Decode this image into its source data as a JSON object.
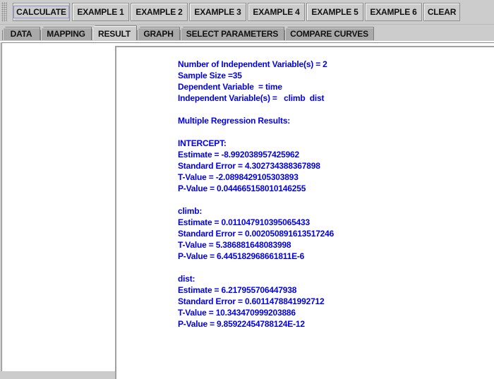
{
  "toolbar": {
    "buttons": [
      {
        "label": "CALCULATE"
      },
      {
        "label": "EXAMPLE 1"
      },
      {
        "label": "EXAMPLE 2"
      },
      {
        "label": "EXAMPLE 3"
      },
      {
        "label": "EXAMPLE 4"
      },
      {
        "label": "EXAMPLE 5"
      },
      {
        "label": "EXAMPLE 6"
      },
      {
        "label": "CLEAR"
      }
    ]
  },
  "tabs": [
    {
      "label": "DATA"
    },
    {
      "label": "MAPPING"
    },
    {
      "label": "RESULT",
      "active": true
    },
    {
      "label": "GRAPH"
    },
    {
      "label": "SELECT PARAMETERS"
    },
    {
      "label": "COMPARE CURVES"
    }
  ],
  "result": {
    "header": {
      "num_independent": "Number of Independent Variable(s) = 2",
      "sample_size": "Sample Size =35",
      "dependent": "Dependent Variable  = time",
      "independent": "Independent Variable(s) =   climb  dist"
    },
    "section_title": "Multiple Regression Results:",
    "terms": [
      {
        "name": "INTERCEPT:",
        "estimate": "Estimate = -8.992038957425962",
        "std_error": "Standard Error = 4.302734388367898",
        "t_value": "T-Value = -2.0898429105303893",
        "p_value": "P-Value = 0.044665158010146255"
      },
      {
        "name": "climb:",
        "estimate": "Estimate = 0.011047910395065433",
        "std_error": "Standard Error = 0.002050891613517246",
        "t_value": "T-Value = 5.386881648083998",
        "p_value": "P-Value = 6.445182968661811E-6"
      },
      {
        "name": "dist:",
        "estimate": "Estimate = 6.217955706447938",
        "std_error": "Standard Error = 0.6011478841992712",
        "t_value": "T-Value = 10.343470999203886",
        "p_value": "P-Value = 9.85922454788124E-12"
      }
    ]
  },
  "colors": {
    "result_text": "#0000ee",
    "background": "#cccccc"
  }
}
